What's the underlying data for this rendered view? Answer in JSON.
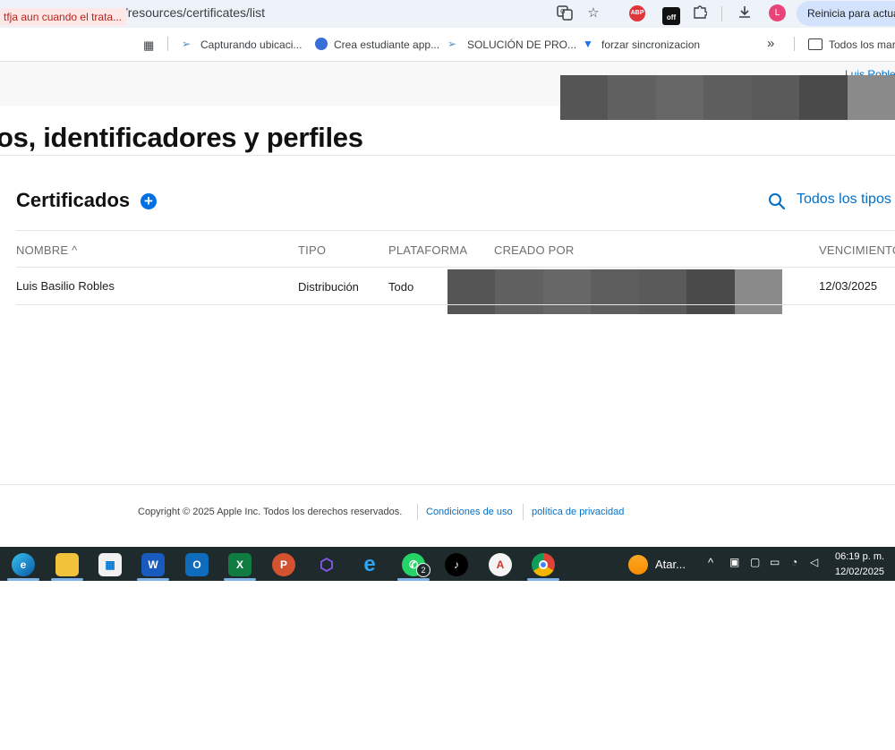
{
  "browser": {
    "url": "per.apple.com/account/resources/certificates/list",
    "restart_button": "Reinicia para actual",
    "toolbar_icons": [
      "translate-icon",
      "star-icon",
      "adblock-icon",
      "extension-off-icon",
      "puzzle-icon",
      "download-icon",
      "profile-avatar"
    ],
    "profile_initial": "L",
    "bookmarks": [
      "tfja aun cuando el trata...",
      "Capturando ubicaci...",
      "Crea estudiante app...",
      "SOLUCIÓN DE PRO...",
      "forzar sincronizacion"
    ],
    "bookmarks_folder": "Todos los marc",
    "more_glyph": "»"
  },
  "page": {
    "user_name": "Luis Robles",
    "title": "os, identificadores y perfiles",
    "section_title": "Certificados",
    "filter_label": "Todos los tipos",
    "table": {
      "columns": [
        "NOMBRE ^",
        "TIPO",
        "PLATAFORMA",
        "CREADO POR",
        "VENCIMIENTO"
      ],
      "rows": [
        {
          "name": "Luis Basilio Robles",
          "type": "Distribución",
          "platform": "Todo",
          "created_by": "",
          "expires": "12/03/2025"
        }
      ]
    }
  },
  "footer": {
    "copyright": "Copyright © 2025 Apple Inc. Todos los derechos reservados.",
    "terms": "Condiciones de uso",
    "privacy": "política de privacidad"
  },
  "taskbar": {
    "apps": [
      "edge",
      "file-explorer",
      "microsoft-store",
      "word",
      "outlook",
      "excel",
      "powerpoint",
      "power-automate",
      "internet-explorer",
      "whatsapp",
      "tiktok",
      "acrobat",
      "chrome"
    ],
    "whatsapp_badge": "2",
    "weather_text": "Atar...",
    "time": "06:19 p. m.",
    "date": "12/02/2025"
  },
  "colors": {
    "accent_blue": "#0071e3",
    "link_blue": "#0070c9",
    "taskbar_bg": "#1f2a2c"
  }
}
